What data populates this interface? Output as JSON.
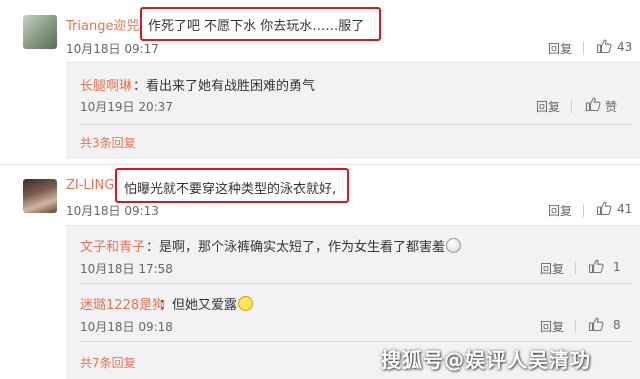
{
  "comments": [
    {
      "user": "Triange迩兕",
      "text": "作死了吧 不愿下水 你去玩水……服了",
      "time": "10月18日 09:17",
      "reply_label": "回复",
      "likes": "43",
      "replies": [
        {
          "user": "长腿啊琳",
          "text": "：看出来了她有战胜困难的勇气",
          "time": "10月19日 20:37",
          "reply_label": "回复",
          "likes": "赞"
        }
      ],
      "more": "共3条回复"
    },
    {
      "user": "ZI-LING",
      "text": "怕曝光就不要穿这种类型的泳衣就好,",
      "time": "10月18日 09:13",
      "reply_label": "回复",
      "likes": "41",
      "replies": [
        {
          "user": "文子和青子",
          "text": "：是啊，那个泳裤确实太短了，作为女生看了都害羞",
          "time": "10月18日 17:58",
          "reply_label": "回复",
          "likes": "1"
        },
        {
          "user": "迷璐1228是狗",
          "text": "：但她又爱露",
          "time": "10月18日 09:18",
          "reply_label": "回复",
          "likes": "8"
        }
      ],
      "more": "共7条回复"
    }
  ],
  "watermark": "搜狐号@娱评人吴清功",
  "icons": [
    "thumb-up-icon",
    "emoji-icon",
    "avatar"
  ],
  "colors": {
    "username": "#eb7350",
    "highlight_border": "#e0141a",
    "reply_bg": "#f2f2f5"
  }
}
